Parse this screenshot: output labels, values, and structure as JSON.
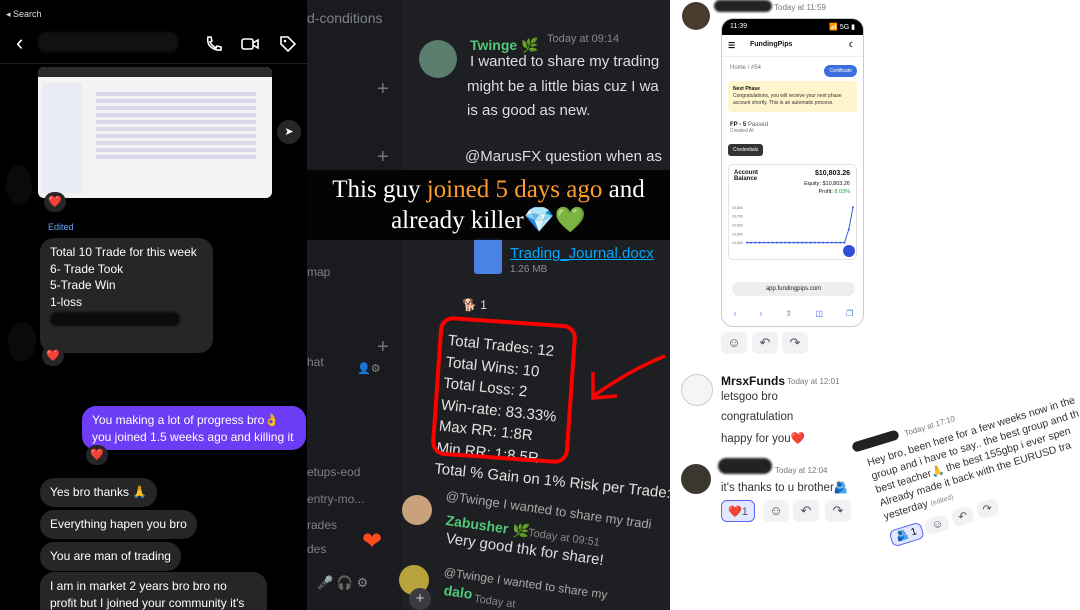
{
  "instagram": {
    "status_back": "◂ Search",
    "edited_label": "Edited",
    "heart": "❤️",
    "messages": [
      {
        "from": "them",
        "lines": [
          "Total 10 Trade for this week",
          "6- Trade Took",
          "5-Trade Win",
          "1-loss"
        ]
      },
      {
        "from": "me",
        "lines": [
          "You making a lot of progress bro👌",
          "you joined 1.5 weeks ago and killing it"
        ]
      },
      {
        "from": "them",
        "text": "Yes bro thanks 🙏"
      },
      {
        "from": "them",
        "text": "Everything hapen you bro"
      },
      {
        "from": "them",
        "text": "You are man of trading"
      },
      {
        "from": "them",
        "lines": [
          "I am in market 2 years bro bro no",
          "profit but I joined your community it's"
        ]
      }
    ]
  },
  "discord_dark": {
    "channel_partial": "d-conditions",
    "channels": [
      "map",
      "hat",
      "etups-eod",
      "entry-mo...",
      "rades",
      "des"
    ],
    "post1": {
      "user": "Twinge 🌿",
      "time": "Today at 09:14",
      "lines": [
        "I wanted to share my trading",
        "might be a little bias cuz I wa",
        "is as good as new."
      ]
    },
    "mention_line": "@MarusFX question when as",
    "file": {
      "name": "Trading_Journal.docx",
      "size": "1.26 MB"
    },
    "reaction_count": "1",
    "stats": [
      "Total Trades: 12",
      "Total Wins: 10",
      "Total Loss: 2",
      "Win-rate: 83.33%",
      "Max RR: 1:8R",
      "Min RR: 1:8.5R",
      "Total % Gain on 1% Risk per Trade:"
    ],
    "reply_ref": "@Twinge I wanted to share my tradi",
    "post2": {
      "user": "Zabusher 🌿",
      "time": "Today at 09:51",
      "text": "Very good thk for share!"
    },
    "reply_ref2": "@Twinge I wanted to share my",
    "post3_user": "dalo",
    "post3_time": "Today at"
  },
  "overlay": {
    "line1a": "This guy ",
    "line1b": "joined 5 days ago",
    "line1c": " and",
    "line2": "already killer💎💚"
  },
  "discord_light": {
    "top_time": "Today at 11:59",
    "phone": {
      "clock": "11:39",
      "signal": "📶 5G ▮",
      "brand": "FundingPips",
      "crumb": "Home  /  #54",
      "cert_btn": "Certificate",
      "note_title": "Next Phase",
      "note_text": "Congratulations, you will receive your next phase account shortly. This is an automatic process.",
      "fp_label": "FP - 5",
      "fp_status": "Passed",
      "fp_created": "Created At",
      "cred_btn": "Credentials",
      "acct_label": "Account Balance",
      "balance": "$10,803.26",
      "equity_label": "Equity:",
      "equity": "$10,803.26",
      "profit_label": "Profit:",
      "profit": "8.03%",
      "url": "app.fundingpips.com"
    },
    "msg1": {
      "user": "MrsxFunds",
      "time": "Today at 12:01",
      "lines": [
        "letsgoo bro",
        "congratulation",
        "happy for you❤️"
      ]
    },
    "msg2": {
      "time": "Today at 12:04",
      "text": "it's thanks to u brother🫂",
      "reaction_count": "1"
    },
    "tilted": {
      "time": "Today at 17:10",
      "lines": [
        "Hey bro, been here for a few weeks now in the",
        "group and i have to say.. the best group and th",
        "best teacher🙏 the best 155gbp i ever spen",
        "Already made it back with the EURUSD tra",
        "yesterday"
      ],
      "edited": "(edited)",
      "reaction_count": "1"
    }
  },
  "chart_data": {
    "type": "line",
    "title": "",
    "x": [
      0,
      1,
      2,
      3,
      4,
      5,
      6,
      7,
      8,
      9,
      10,
      11,
      12,
      13,
      14,
      15,
      16,
      17,
      18,
      19,
      20,
      21,
      22,
      23,
      24,
      25
    ],
    "values": [
      10400,
      10400,
      10400,
      10400,
      10400,
      10400,
      10400,
      10400,
      10400,
      10400,
      10400,
      10400,
      10400,
      10400,
      10400,
      10400,
      10400,
      10400,
      10400,
      10400,
      10400,
      10400,
      10400,
      10400,
      10550,
      10800
    ],
    "ylim": [
      10350,
      10850
    ],
    "ticks": [
      "10,800",
      "10,700",
      "10,600",
      "10,500",
      "10,400"
    ]
  }
}
